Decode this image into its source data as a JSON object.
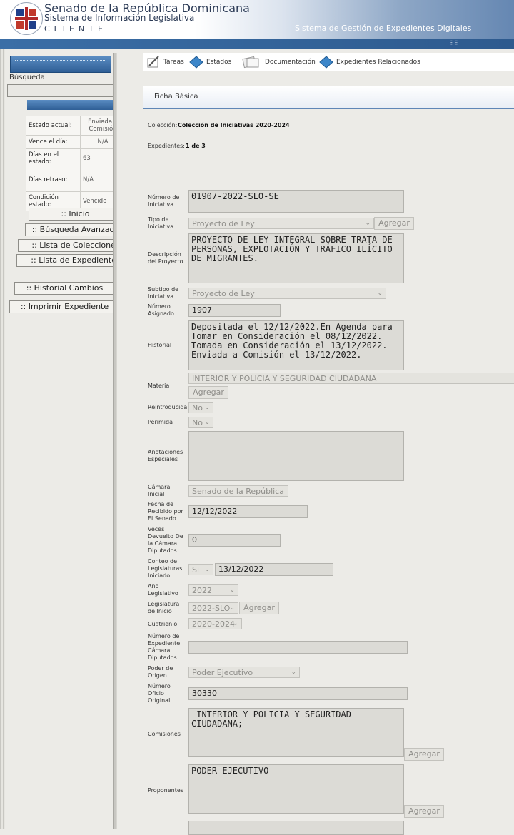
{
  "header": {
    "title1": "Senado de la República Dominicana",
    "title2": "Sistema de Información Legislativa",
    "title3": "CLIENTE",
    "subtitle": "Sistema de Gestión de Expedientes Digitales"
  },
  "sidebar": {
    "search_label": "Búsqueda",
    "search_value": "",
    "state_table": [
      {
        "label": "Estado actual:",
        "value": "Enviada a Comisión"
      },
      {
        "label": "Vence el día:",
        "value": "N/A"
      },
      {
        "label": "Días en el estado:",
        "value": "63"
      },
      {
        "label": "Días retraso:",
        "value": "N/A"
      },
      {
        "label": "Condición estado:",
        "value": "Vencido"
      }
    ],
    "buttons": [
      ":: Inicio",
      ":: Búsqueda Avanzada",
      ":: Lista de Colecciones",
      ":: Lista de Expedientes",
      ":: Historial Cambios",
      ":: Imprimir Expediente"
    ]
  },
  "tabs": [
    {
      "label": "Tareas",
      "icon": "pencil-icon"
    },
    {
      "label": "Estados",
      "icon": "diamond-icon"
    },
    {
      "label": "Documentación",
      "icon": "documents-icon"
    },
    {
      "label": "Expedientes Relacionados",
      "icon": "diamond-icon"
    }
  ],
  "ficha": {
    "section_title": "Ficha Básica",
    "coleccion_label": "Colección:",
    "coleccion_value": "Colección de Iniciativas 2020-2024",
    "expedientes_label": "Expedientes:",
    "expedientes_value": "1 de 3"
  },
  "form": {
    "numero_iniciativa": {
      "label": "Número de Iniciativa",
      "value": "01907-2022-SLO-SE"
    },
    "tipo_iniciativa": {
      "label": "Tipo de Iniciativa",
      "value": "Proyecto de Ley",
      "button": "Agregar"
    },
    "descripcion": {
      "label": "Descripción del Proyecto",
      "value": "PROYECTO DE LEY INTEGRAL SOBRE TRATA DE PERSONAS, EXPLOTACIÓN Y TRÁFICO ILÍCITO DE MIGRANTES."
    },
    "subtipo": {
      "label": "Subtipo de Iniciativa",
      "value": "Proyecto de Ley"
    },
    "numero_asignado": {
      "label": "Número Asignado",
      "value": "1907"
    },
    "historial": {
      "label": "Historial",
      "value": "Depositada el 12/12/2022.En Agenda para Tomar en Consideración el 08/12/2022. Tomada en Consideración el 13/12/2022. Enviada a Comisión el 13/12/2022."
    },
    "materia": {
      "label": "Materia",
      "value": "INTERIOR Y POLICIA Y SEGURIDAD CIUDADANA",
      "button": "Agregar"
    },
    "reintroducida": {
      "label": "Reintroducida",
      "value": "No"
    },
    "perimida": {
      "label": "Perimida",
      "value": "No"
    },
    "anotaciones": {
      "label": "Anotaciones Especiales",
      "value": ""
    },
    "camara_inicial": {
      "label": "Cámara Inicial",
      "value": "Senado de la República"
    },
    "fecha_recibido": {
      "label": "Fecha de Recibido por El Senado",
      "value": "12/12/2022"
    },
    "veces_devuelto": {
      "label": "Veces Devuelto De la Cámara Diputados",
      "value": "0"
    },
    "conteo_legislaturas": {
      "label": "Conteo de Legislaturas Iniciado",
      "select": "Si",
      "value": "13/12/2022"
    },
    "anio_legislativo": {
      "label": "Año Legislativo",
      "value": "2022"
    },
    "legislatura_inicio": {
      "label": "Legislatura de Inicio",
      "value": "2022-SLO",
      "button": "Agregar"
    },
    "cuatrienio": {
      "label": "Cuatrienio",
      "value": "2020-2024"
    },
    "numero_expediente_diputados": {
      "label": "Número de Expediente Cámara Diputados",
      "value": ""
    },
    "poder_origen": {
      "label": "Poder de Origen",
      "value": "Poder Ejecutivo"
    },
    "numero_oficio": {
      "label": "Número Oficio Original",
      "value": "30330"
    },
    "comisiones": {
      "label": "Comisiones",
      "value": " INTERIOR Y POLICIA Y SEGURIDAD CIUDADANA;",
      "button": "Agregar"
    },
    "proponentes": {
      "label": "Proponentes",
      "value": "PODER EJECUTIVO",
      "button": "Agregar"
    }
  },
  "colors": {
    "brand_blue": "#2f5f96",
    "field_bg": "#dcdbd6",
    "page_bg": "#ecebe7"
  }
}
